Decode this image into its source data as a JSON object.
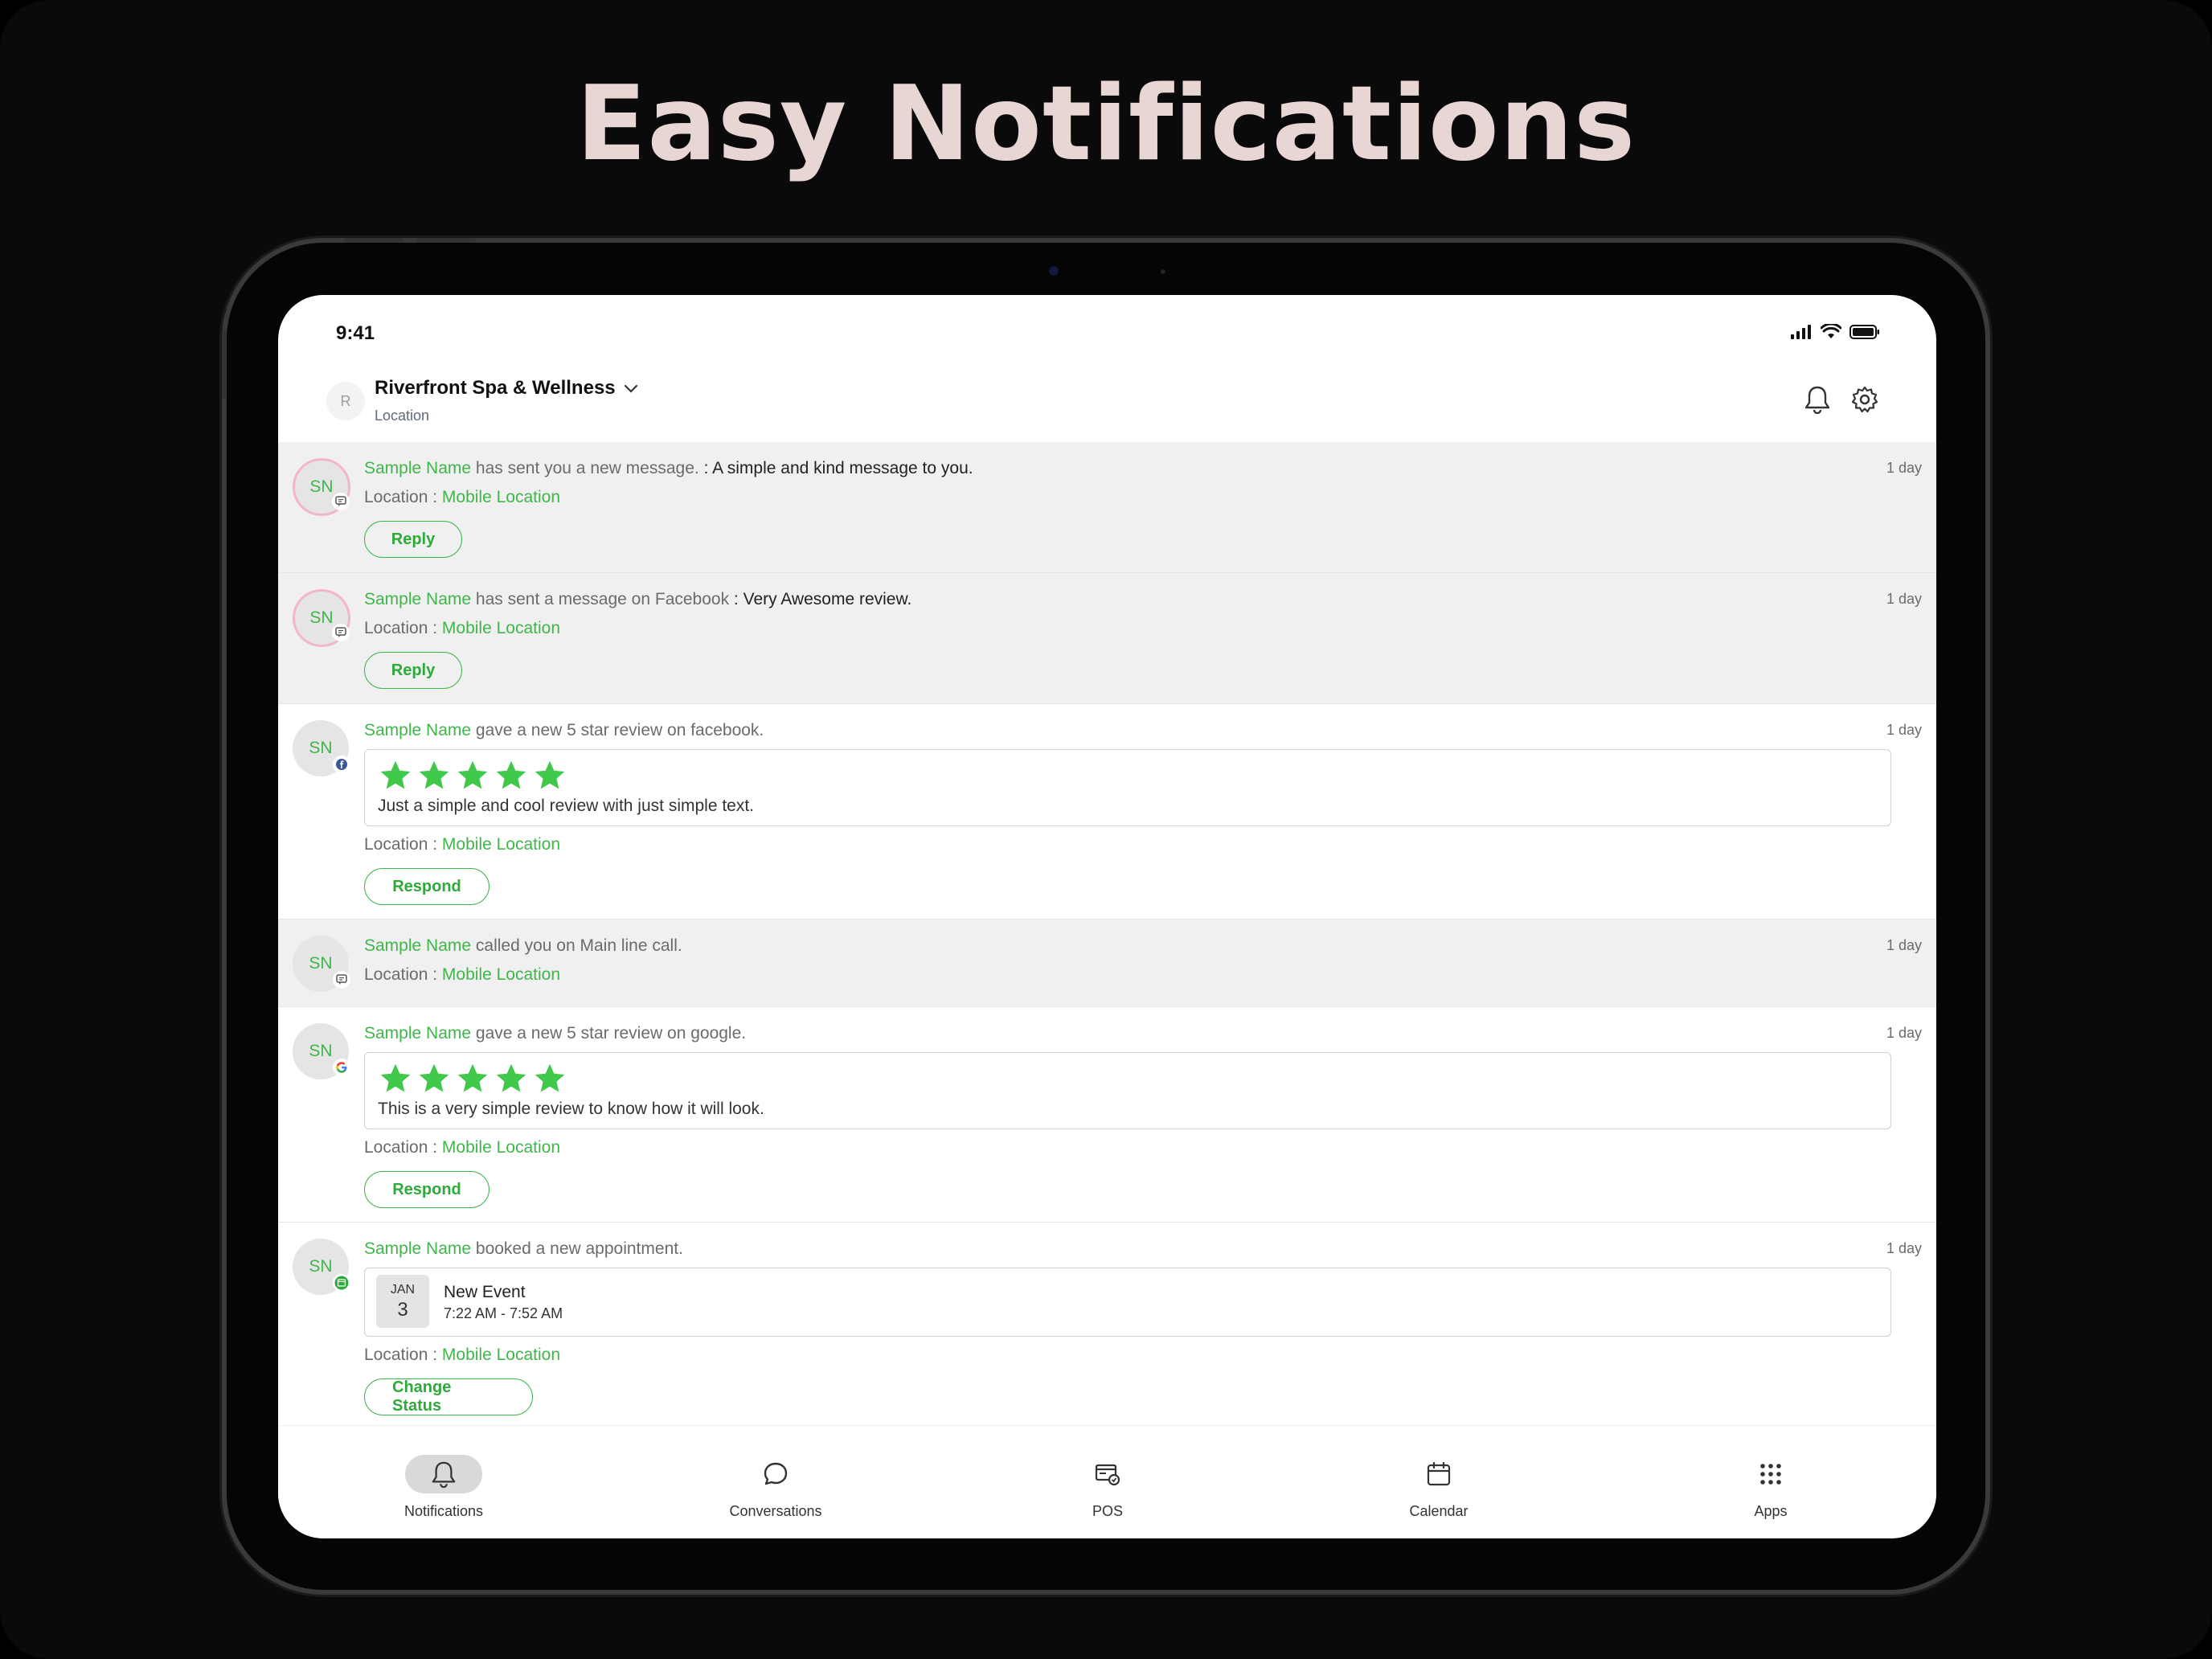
{
  "headline": "Easy Notifications",
  "status_bar": {
    "time": "9:41"
  },
  "header": {
    "avatar_initial": "R",
    "location_name": "Riverfront Spa & Wellness",
    "location_label": "Location"
  },
  "notifications": [
    {
      "initials": "SN",
      "name": "Sample Name",
      "action": " has sent you a new message.",
      "message": " : A simple and kind message to you.",
      "time": "1 day",
      "location_prefix": "Location : ",
      "location": "Mobile Location",
      "button": "Reply"
    },
    {
      "initials": "SN",
      "name": "Sample Name",
      "action": " has sent a message on Facebook",
      "message": " : Very Awesome review.",
      "time": "1 day",
      "location_prefix": "Location : ",
      "location": "Mobile Location",
      "button": "Reply"
    },
    {
      "initials": "SN",
      "name": "Sample Name",
      "action": " gave a new 5 star review on facebook.",
      "time": "1 day",
      "rating": 5,
      "review": "Just a simple and cool review with just simple text.",
      "location_prefix": "Location : ",
      "location": "Mobile Location",
      "button": "Respond"
    },
    {
      "initials": "SN",
      "name": "Sample Name",
      "action": " called you on Main line call.",
      "time": "1 day",
      "location_prefix": "Location : ",
      "location": "Mobile Location"
    },
    {
      "initials": "SN",
      "name": "Sample Name",
      "action": " gave a new 5 star review on google.",
      "time": "1 day",
      "rating": 5,
      "review": "This is a very simple review to know how it will look.",
      "location_prefix": "Location : ",
      "location": "Mobile Location",
      "button": "Respond"
    },
    {
      "initials": "SN",
      "name": "Sample Name",
      "action": " booked a new appointment.",
      "time": "1 day",
      "appointment": {
        "month": "JAN",
        "day": "3",
        "title": "New Event",
        "time": "7:22 AM - 7:52 AM"
      },
      "location_prefix": "Location : ",
      "location": "Mobile Location",
      "button": "Change Status"
    }
  ],
  "tabs": [
    {
      "label": "Notifications",
      "icon": "bell-icon",
      "active": true
    },
    {
      "label": "Conversations",
      "icon": "chat-bubble-icon"
    },
    {
      "label": "POS",
      "icon": "pos-icon"
    },
    {
      "label": "Calendar",
      "icon": "calendar-icon"
    },
    {
      "label": "Apps",
      "icon": "apps-grid-icon"
    }
  ],
  "colors": {
    "accent": "#3fb64a",
    "headline": "#e8d6d4",
    "unread_row": "#f0f0f0"
  }
}
